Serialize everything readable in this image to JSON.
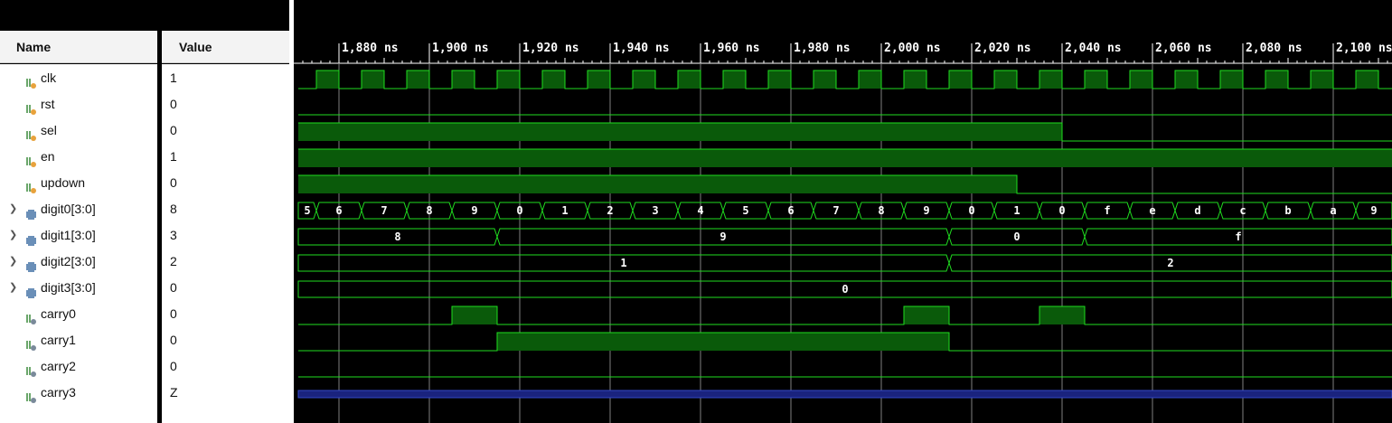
{
  "columns": {
    "name": "Name",
    "value": "Value"
  },
  "signals": [
    {
      "name": "clk",
      "value": "1",
      "kind": "wire-in",
      "expandable": false
    },
    {
      "name": "rst",
      "value": "0",
      "kind": "wire-in",
      "expandable": false
    },
    {
      "name": "sel",
      "value": "0",
      "kind": "wire-in",
      "expandable": false
    },
    {
      "name": "en",
      "value": "1",
      "kind": "wire-in",
      "expandable": false
    },
    {
      "name": "updown",
      "value": "0",
      "kind": "wire-in",
      "expandable": false
    },
    {
      "name": "digit0[3:0]",
      "value": "8",
      "kind": "bus",
      "expandable": true
    },
    {
      "name": "digit1[3:0]",
      "value": "3",
      "kind": "bus",
      "expandable": true
    },
    {
      "name": "digit2[3:0]",
      "value": "2",
      "kind": "bus",
      "expandable": true
    },
    {
      "name": "digit3[3:0]",
      "value": "0",
      "kind": "bus",
      "expandable": true
    },
    {
      "name": "carry0",
      "value": "0",
      "kind": "wire-out",
      "expandable": false
    },
    {
      "name": "carry1",
      "value": "0",
      "kind": "wire-out",
      "expandable": false
    },
    {
      "name": "carry2",
      "value": "0",
      "kind": "wire-out",
      "expandable": false
    },
    {
      "name": "carry3",
      "value": "Z",
      "kind": "wire-out",
      "expandable": false
    }
  ],
  "timescale": {
    "unit": "ns",
    "labels": [
      "1,880 ns",
      "1,900 ns",
      "1,920 ns",
      "1,940 ns",
      "1,960 ns",
      "1,980 ns",
      "2,000 ns",
      "2,020 ns",
      "2,040 ns",
      "2,060 ns",
      "2,080 ns",
      "2,100 ns"
    ],
    "label_values": [
      1880,
      1900,
      1920,
      1940,
      1960,
      1980,
      2000,
      2020,
      2040,
      2060,
      2080,
      2100
    ],
    "view_start": 1871,
    "view_end": 2114
  },
  "waveforms": {
    "clk": {
      "type": "clock",
      "first_rise": 1875,
      "period": 10,
      "high": 5
    },
    "rst": {
      "type": "bit",
      "segments": [
        [
          1871,
          2114,
          0
        ]
      ]
    },
    "sel": {
      "type": "bit",
      "segments": [
        [
          1871,
          2040,
          1
        ],
        [
          2040,
          2114,
          0
        ]
      ]
    },
    "en": {
      "type": "bit",
      "segments": [
        [
          1871,
          2114,
          1
        ]
      ]
    },
    "updown": {
      "type": "bit",
      "segments": [
        [
          1871,
          2030,
          1
        ],
        [
          2030,
          2114,
          0
        ]
      ]
    },
    "digit0[3:0]": {
      "type": "bus",
      "segments": [
        [
          1871,
          1875,
          "5"
        ],
        [
          1875,
          1885,
          "6"
        ],
        [
          1885,
          1895,
          "7"
        ],
        [
          1895,
          1905,
          "8"
        ],
        [
          1905,
          1915,
          "9"
        ],
        [
          1915,
          1925,
          "0"
        ],
        [
          1925,
          1935,
          "1"
        ],
        [
          1935,
          1945,
          "2"
        ],
        [
          1945,
          1955,
          "3"
        ],
        [
          1955,
          1965,
          "4"
        ],
        [
          1965,
          1975,
          "5"
        ],
        [
          1975,
          1985,
          "6"
        ],
        [
          1985,
          1995,
          "7"
        ],
        [
          1995,
          2005,
          "8"
        ],
        [
          2005,
          2015,
          "9"
        ],
        [
          2015,
          2025,
          "0"
        ],
        [
          2025,
          2035,
          "1"
        ],
        [
          2035,
          2045,
          "0"
        ],
        [
          2045,
          2055,
          "f"
        ],
        [
          2055,
          2065,
          "e"
        ],
        [
          2065,
          2075,
          "d"
        ],
        [
          2075,
          2085,
          "c"
        ],
        [
          2085,
          2095,
          "b"
        ],
        [
          2095,
          2105,
          "a"
        ],
        [
          2105,
          2114,
          "9"
        ]
      ]
    },
    "digit1[3:0]": {
      "type": "bus",
      "segments": [
        [
          1871,
          1915,
          "8"
        ],
        [
          1915,
          2015,
          "9"
        ],
        [
          2015,
          2045,
          "0"
        ],
        [
          2045,
          2114,
          "f"
        ]
      ]
    },
    "digit2[3:0]": {
      "type": "bus",
      "segments": [
        [
          1871,
          2015,
          "1"
        ],
        [
          2015,
          2114,
          "2"
        ]
      ]
    },
    "digit3[3:0]": {
      "type": "bus",
      "segments": [
        [
          1871,
          2114,
          "0"
        ]
      ]
    },
    "carry0": {
      "type": "bit",
      "segments": [
        [
          1871,
          1905,
          0
        ],
        [
          1905,
          1915,
          1
        ],
        [
          1915,
          2005,
          0
        ],
        [
          2005,
          2015,
          1
        ],
        [
          2015,
          2035,
          0
        ],
        [
          2035,
          2045,
          1
        ],
        [
          2045,
          2114,
          0
        ]
      ]
    },
    "carry1": {
      "type": "bit",
      "segments": [
        [
          1871,
          1915,
          0
        ],
        [
          1915,
          2015,
          1
        ],
        [
          2015,
          2114,
          0
        ]
      ]
    },
    "carry2": {
      "type": "bit",
      "segments": [
        [
          1871,
          2114,
          0
        ]
      ]
    },
    "carry3": {
      "type": "z",
      "segments": [
        [
          1871,
          2114,
          "Z"
        ]
      ]
    }
  },
  "colors": {
    "wave": "#1fdc1f",
    "wave_fill": "#0a5a0a",
    "z_fill": "#1a237e",
    "z_edge": "#3448c8",
    "grid": "#7f7f7f",
    "ruler_text": "#ffffff",
    "icon_in": "#e8a23c",
    "icon_out": "#7a8a9a",
    "icon_bus": "#6a8fb8"
  }
}
